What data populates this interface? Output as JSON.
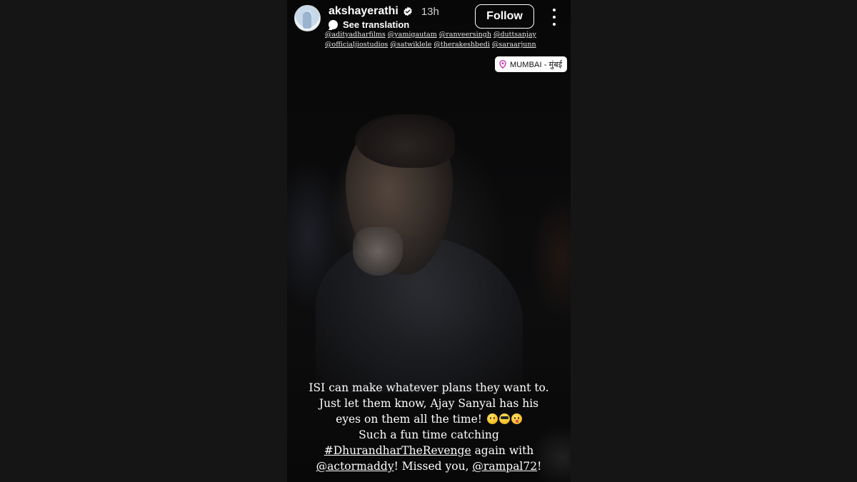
{
  "story": {
    "username": "akshayerathi",
    "time_ago": "13h",
    "see_translation_label": "See translation",
    "follow_label": "Follow",
    "mentions": [
      "@adityadharfilms",
      "@yamigautam",
      "@ranveersingh",
      "@duttsanjay",
      "@officialjiostudios",
      "@satwiklele",
      "@therakeshbedi",
      "@saraarjunn"
    ],
    "location": "MUMBAI - मुंबई",
    "caption": {
      "line1": "ISI can make whatever plans they want to.",
      "line2": "Just let them know, Ajay Sanyal has his",
      "line3": "eyes on them all the time!",
      "line4": "Such a fun time catching",
      "hashtag": "#DhurandharTheRevenge",
      "line5_rest": " again with",
      "mention1": "@actormaddy",
      "line6_mid": "! Missed you, ",
      "mention2": "@rampal72",
      "line6_end": "!"
    },
    "emojis": [
      "winking-face",
      "smiling-face-with-sunglasses",
      "winking-face-with-tongue"
    ]
  },
  "colors": {
    "background": "#151515",
    "story_background": "#050505",
    "text": "#ffffff",
    "verified_badge": "#ffffff",
    "location_pin": "#c837ab"
  }
}
